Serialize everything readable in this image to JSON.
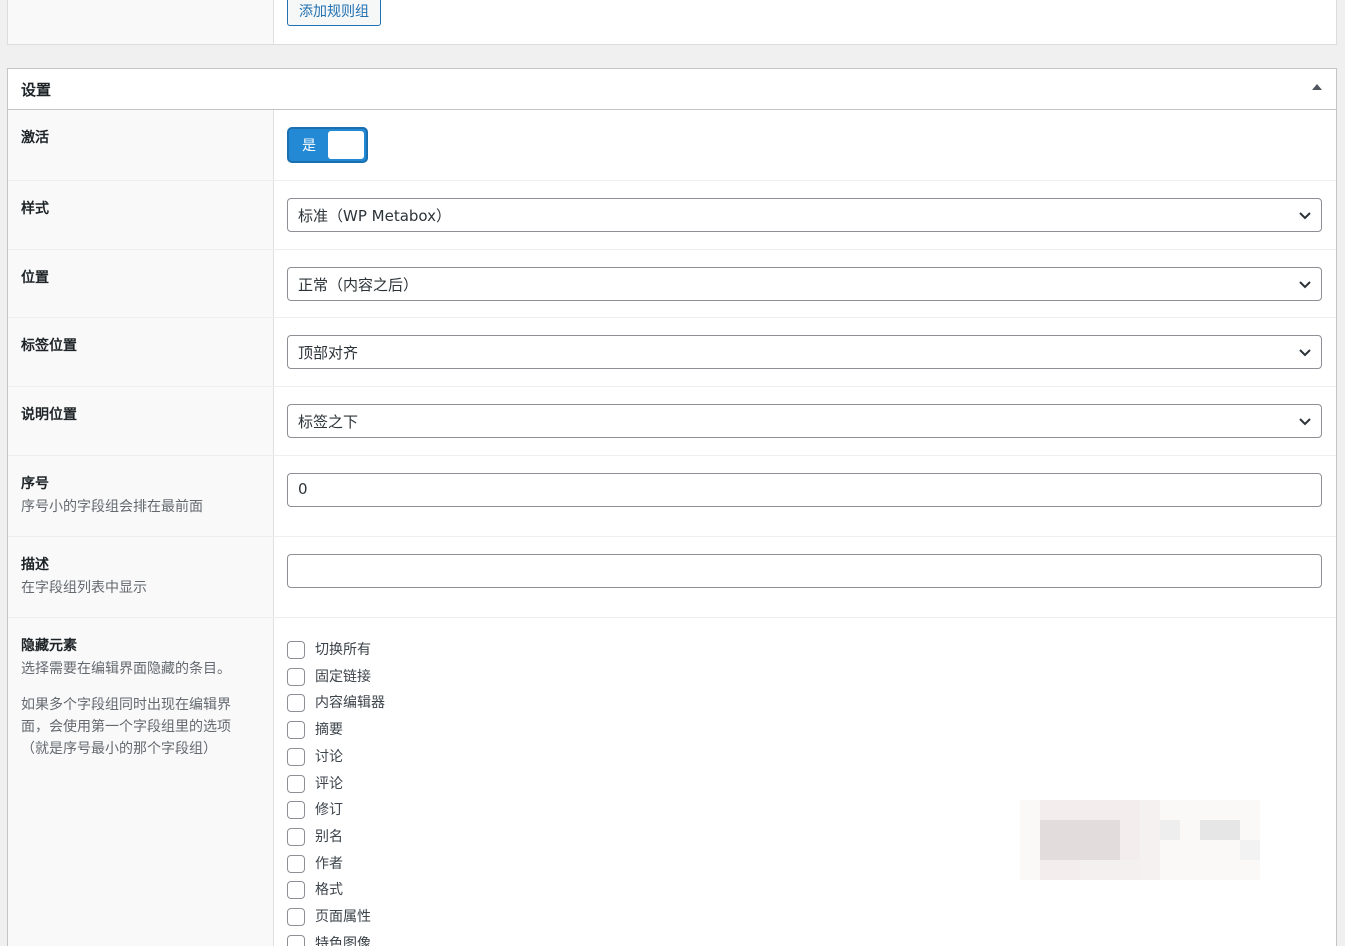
{
  "top": {
    "add_rule_group": "添加规则组"
  },
  "settings": {
    "title": "设置",
    "active": {
      "label": "激活",
      "toggle_text": "是"
    },
    "style": {
      "label": "样式",
      "value": "标准（WP Metabox）"
    },
    "position": {
      "label": "位置",
      "value": "正常（内容之后）"
    },
    "label_placement": {
      "label": "标签位置",
      "value": "顶部对齐"
    },
    "instruction_placement": {
      "label": "说明位置",
      "value": "标签之下"
    },
    "order": {
      "label": "序号",
      "help": "序号小的字段组会排在最前面",
      "value": "0"
    },
    "description": {
      "label": "描述",
      "help": "在字段组列表中显示",
      "value": ""
    },
    "hide_on_screen": {
      "label": "隐藏元素",
      "help1": "选择需要在编辑界面隐藏的条目。",
      "help2": "如果多个字段组同时出现在编辑界面，会使用第一个字段组里的选项（就是序号最小的那个字段组）",
      "items": [
        "切换所有",
        "固定链接",
        "内容编辑器",
        "摘要",
        "讨论",
        "评论",
        "修订",
        "别名",
        "作者",
        "格式",
        "页面属性",
        "特色图像"
      ]
    }
  },
  "colors": {
    "toggle_bg": "#2389d4",
    "accent": "#2271b1"
  }
}
